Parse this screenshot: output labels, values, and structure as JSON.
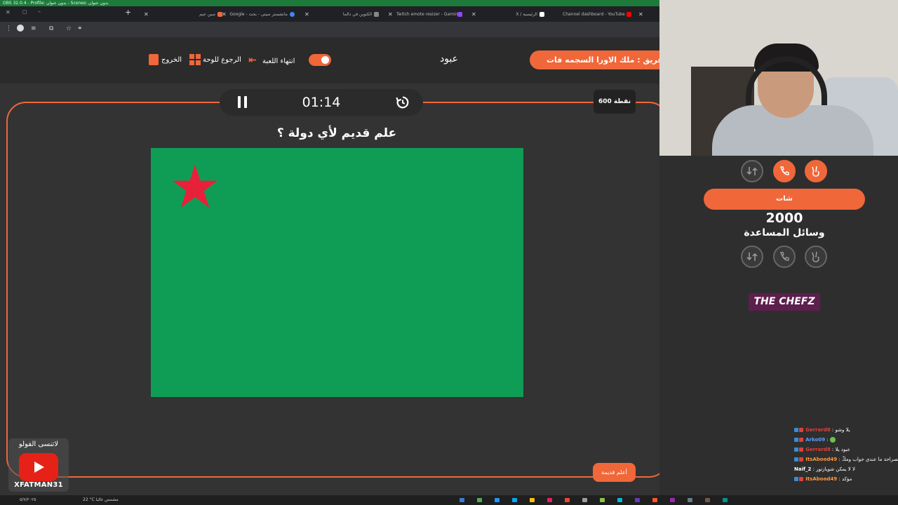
{
  "obs_title": "OBS 32.0.4 - Profile: بدون عنوان - Scenes: بدون عنوان",
  "browser": {
    "tabs": [
      {
        "label": "سين جيم",
        "color": "#f0673a"
      },
      {
        "label": "Google - مانشستر سيتي - بحث",
        "color": "#4285f4"
      },
      {
        "label": "الكنوين في دالما",
        "color": "#888888"
      },
      {
        "label": "Twitch emote resizer - Gaming",
        "color": "#9146ff"
      },
      {
        "label": "X / الرئيسية",
        "color": "#ffffff"
      },
      {
        "label": "Channel dashboard - YouTube",
        "color": "#ff0000"
      }
    ],
    "new_tab": "+",
    "address_icon": "site-info-icon"
  },
  "header": {
    "team_label": "فريق : ملك الاورا السجمه فات",
    "player_name": "عبود",
    "end_game_label": "انتهاء اللعبة",
    "back_to_board_label": "الرجوع للوحة",
    "exit_label": "الخروج"
  },
  "game": {
    "timer": "01:14",
    "points": "600 نقطة",
    "question": "علم قديم لأي دولة ؟",
    "flag_colors": {
      "field": "#0f9d55",
      "star": "#e8213b"
    },
    "help_label": "أعلم قديمة"
  },
  "side": {
    "chat_button": "شات",
    "score": "2000",
    "aids_label": "وسائل المساعدة",
    "sponsor": "THE CHEFZ"
  },
  "chat": [
    {
      "user": "Gerrard8",
      "msg": "يلا وشو",
      "color": "#e0403a"
    },
    {
      "user": "Arko09",
      "msg": "",
      "color": "#5aa0ff"
    },
    {
      "user": "Gerrard8",
      "msg": "عبود يلا",
      "color": "#e0403a"
    },
    {
      "user": "ItsAbood49",
      "msg": "مدري الصراحة ما عندي جواب ومكّ",
      "color": "#ff9a3c"
    },
    {
      "user": "Naif_2",
      "msg": "لا لا يمكن شويازتور",
      "color": "#ffffff"
    },
    {
      "user": "ItsAbood49",
      "msg": "مؤكد",
      "color": "#ff9a3c"
    }
  ],
  "youtube_promo": {
    "top_text": "لاتنسى الفولو",
    "channel": "XFATMAN31"
  },
  "taskbar": {
    "date": "٥/٧/٢٠٢٥",
    "weather": "22 °C مشمس غالبا"
  }
}
